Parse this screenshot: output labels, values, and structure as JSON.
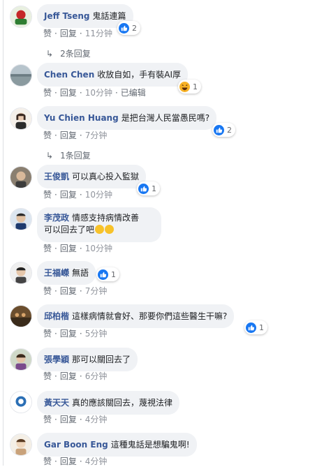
{
  "action_labels": {
    "like": "赞",
    "reply": "回复",
    "separator": "·",
    "edited": "已编辑"
  },
  "comments": [
    {
      "author": "Jeff Tseng",
      "text": "鬼話連篇",
      "reaction_count": "2",
      "reaction": "like",
      "time": "11分钟",
      "replies": "2条回复"
    },
    {
      "author": "Chen Chen",
      "text": "收放自如，手有裝AI厚",
      "reaction_count": "1",
      "reaction": "haha",
      "time": "10分钟",
      "edited": true
    },
    {
      "author": "Yu Chien Huang",
      "text": "是把台灣人民當愚民嗎?",
      "reaction_count": "2",
      "reaction": "like",
      "time": "7分钟",
      "replies": "1条回复"
    },
    {
      "author": "王俊凱",
      "text": "可以真心投入監獄",
      "reaction_count": "1",
      "reaction": "like",
      "time": "10分钟"
    },
    {
      "author": "李茂政",
      "text": "情感支持病情改善",
      "text_line2": "可以回去了吧",
      "emojis": [
        "rolling-eyes-emoji",
        "grinning-emoji"
      ],
      "time": "10分钟"
    },
    {
      "author": "王福嶸",
      "text": "無語",
      "reaction_count": "1",
      "reaction": "like",
      "time": "7分钟"
    },
    {
      "author": "邱柏楷",
      "text": "這樣病情就會好、那要你們這些醫生干嘛?",
      "reaction_count": "1",
      "reaction": "like",
      "time": "5分钟"
    },
    {
      "author": "張學穎",
      "text": "那可以關回去了",
      "time": "6分钟"
    },
    {
      "author": "黃天天",
      "text": "真的應該關回去，蔑視法律",
      "time": "4分钟"
    },
    {
      "author": "Gar Boon Eng",
      "text": "這種鬼話是想騙鬼啊!",
      "time": "4分钟"
    }
  ],
  "colors": {
    "author": "#385898",
    "like_blue": "#1877f2",
    "bubble": "#f0f2f5",
    "meta": "#606770"
  }
}
